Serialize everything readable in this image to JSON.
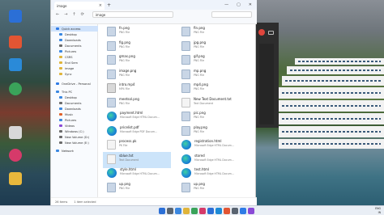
{
  "explorer": {
    "tab_title": "image",
    "address_path": "image",
    "nav": [
      {
        "label": "Quick access",
        "selected": true,
        "sub": false,
        "color": "#2f7be6"
      },
      {
        "label": "Desktop",
        "selected": false,
        "sub": true,
        "color": "#3a87e0"
      },
      {
        "label": "Downloads",
        "selected": false,
        "sub": true,
        "color": "#3a87e0"
      },
      {
        "label": "Documents",
        "selected": false,
        "sub": true,
        "color": "#6a6a6a"
      },
      {
        "label": "Pictures",
        "selected": false,
        "sub": true,
        "color": "#3a87e0"
      },
      {
        "label": "CSRS",
        "selected": false,
        "sub": true,
        "color": "#e0b43a"
      },
      {
        "label": "End Sem",
        "selected": false,
        "sub": true,
        "color": "#e0b43a"
      },
      {
        "label": "image",
        "selected": false,
        "sub": true,
        "color": "#e0b43a"
      },
      {
        "label": "Sync",
        "selected": false,
        "sub": true,
        "color": "#e0b43a"
      },
      {
        "label": "OneDrive - Personal",
        "selected": false,
        "sub": false,
        "color": "#2f7be6"
      },
      {
        "label": "This PC",
        "selected": false,
        "sub": false,
        "color": "#3a87e0"
      },
      {
        "label": "Desktop",
        "selected": false,
        "sub": true,
        "color": "#3a87e0"
      },
      {
        "label": "Documents",
        "selected": false,
        "sub": true,
        "color": "#6a6a6a"
      },
      {
        "label": "Downloads",
        "selected": false,
        "sub": true,
        "color": "#3a87e0"
      },
      {
        "label": "Music",
        "selected": false,
        "sub": true,
        "color": "#e0602a"
      },
      {
        "label": "Pictures",
        "selected": false,
        "sub": true,
        "color": "#3a87e0"
      },
      {
        "label": "Videos",
        "selected": false,
        "sub": true,
        "color": "#8a4ad6"
      },
      {
        "label": "Windows (C:)",
        "selected": false,
        "sub": true,
        "color": "#6a6a6a"
      },
      {
        "label": "New Volume (D:)",
        "selected": false,
        "sub": true,
        "color": "#6a6a6a"
      },
      {
        "label": "New Volume (E:)",
        "selected": false,
        "sub": true,
        "color": "#6a6a6a"
      },
      {
        "label": "Network",
        "selected": false,
        "sub": false,
        "color": "#3a87e0"
      }
    ],
    "files_left": [
      {
        "name": "fn.png",
        "meta": "PNG File",
        "icon": "img",
        "selected": false
      },
      {
        "name": "fig.png",
        "meta": "PNG File",
        "icon": "img",
        "selected": false
      },
      {
        "name": "gmas.png",
        "meta": "PNG File",
        "icon": "img",
        "selected": false
      },
      {
        "name": "image.png",
        "meta": "PNG File",
        "icon": "img",
        "selected": false
      },
      {
        "name": "intro.mp4",
        "meta": "MP4 File",
        "icon": "mp4",
        "selected": false
      },
      {
        "name": "meetsol.png",
        "meta": "PNG File",
        "icon": "img",
        "selected": false
      },
      {
        "name": "payment.html",
        "meta": "Microsoft Edge HTML Docum...",
        "icon": "edge",
        "selected": false
      },
      {
        "name": "pricelist.pdf",
        "meta": "Microsoft Edge PDF Docum...",
        "icon": "edge",
        "selected": false
      },
      {
        "name": "process.pk",
        "meta": "PK File",
        "icon": "doc",
        "selected": false
      },
      {
        "name": "sblue.txt",
        "meta": "Text Document",
        "icon": "doc",
        "selected": true
      },
      {
        "name": "style.html",
        "meta": "Microsoft Edge HTML Docum...",
        "icon": "edge",
        "selected": false
      },
      {
        "name": "up.png",
        "meta": "PNG File",
        "icon": "img",
        "selected": false
      }
    ],
    "files_right": [
      {
        "name": "fin.png",
        "meta": "PNG File",
        "icon": "img",
        "selected": false
      },
      {
        "name": "jpg.png",
        "meta": "PNG File",
        "icon": "img",
        "selected": false
      },
      {
        "name": "gif.png",
        "meta": "PNG File",
        "icon": "img",
        "selected": false
      },
      {
        "name": "mp.png",
        "meta": "PNG File",
        "icon": "img",
        "selected": false
      },
      {
        "name": "mp4.png",
        "meta": "PNG File",
        "icon": "img",
        "selected": false
      },
      {
        "name": "New Text Document.txt",
        "meta": "Text Document",
        "icon": "doc",
        "selected": false
      },
      {
        "name": "pic.png",
        "meta": "PNG File",
        "icon": "img",
        "selected": false
      },
      {
        "name": "play.png",
        "meta": "PNG File",
        "icon": "img",
        "selected": false
      },
      {
        "name": "registration.html",
        "meta": "Microsoft Edge HTML Docum...",
        "icon": "edge",
        "selected": false
      },
      {
        "name": "stored",
        "meta": "Microsoft Edge HTML Docum...",
        "icon": "edge",
        "selected": false
      },
      {
        "name": "test.html",
        "meta": "Microsoft Edge HTML Docum...",
        "icon": "edge",
        "selected": false
      },
      {
        "name": "up.png",
        "meta": "PNG File",
        "icon": "img",
        "selected": false
      }
    ],
    "status": {
      "item_count": "26 items",
      "selection": "1 item selected"
    }
  },
  "taskbar": {
    "tray_line1": "ENG",
    "tray_line2": "IN"
  }
}
